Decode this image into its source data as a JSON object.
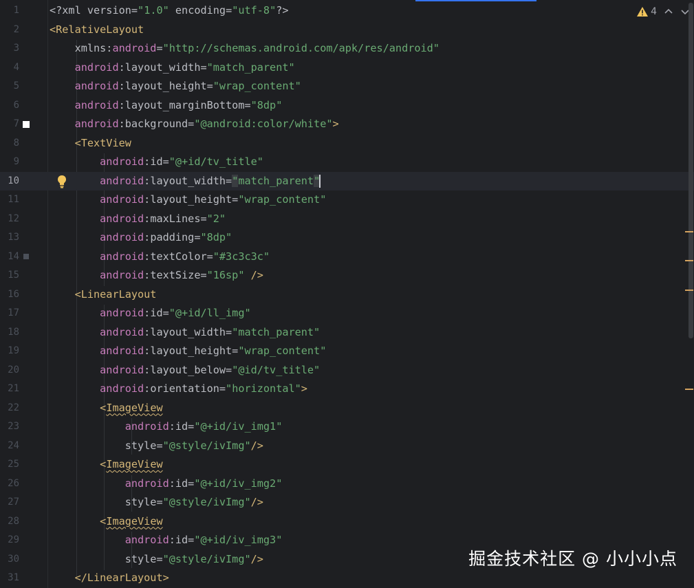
{
  "editor": {
    "current_line": 10,
    "lines": [
      {
        "n": "1",
        "segments": [
          {
            "t": "<?xml ",
            "c": "pi"
          },
          {
            "t": "version",
            "c": "attr"
          },
          {
            "t": "=",
            "c": "attr"
          },
          {
            "t": "\"1.0\"",
            "c": "val"
          },
          {
            "t": " encoding",
            "c": "attr"
          },
          {
            "t": "=",
            "c": "attr"
          },
          {
            "t": "\"utf-8\"",
            "c": "val"
          },
          {
            "t": "?>",
            "c": "pi"
          }
        ]
      },
      {
        "n": "2",
        "segments": [
          {
            "t": "<RelativeLayout",
            "c": "tag"
          }
        ]
      },
      {
        "n": "3",
        "segments": [
          {
            "t": "    xmlns:",
            "c": "attr"
          },
          {
            "t": "android",
            "c": "attr-ns"
          },
          {
            "t": "=",
            "c": "attr"
          },
          {
            "t": "\"http://schemas.android.com/apk/res/android\"",
            "c": "val"
          }
        ]
      },
      {
        "n": "4",
        "segments": [
          {
            "t": "    ",
            "c": "attr"
          },
          {
            "t": "android",
            "c": "attr-ns"
          },
          {
            "t": ":layout_width=",
            "c": "attr"
          },
          {
            "t": "\"match_parent\"",
            "c": "val"
          }
        ]
      },
      {
        "n": "5",
        "segments": [
          {
            "t": "    ",
            "c": "attr"
          },
          {
            "t": "android",
            "c": "attr-ns"
          },
          {
            "t": ":layout_height=",
            "c": "attr"
          },
          {
            "t": "\"wrap_content\"",
            "c": "val"
          }
        ]
      },
      {
        "n": "6",
        "segments": [
          {
            "t": "    ",
            "c": "attr"
          },
          {
            "t": "android",
            "c": "attr-ns"
          },
          {
            "t": ":layout_marginBottom=",
            "c": "attr"
          },
          {
            "t": "\"8dp\"",
            "c": "val"
          }
        ]
      },
      {
        "n": "7",
        "segments": [
          {
            "t": "    ",
            "c": "attr"
          },
          {
            "t": "android",
            "c": "attr-ns"
          },
          {
            "t": ":background=",
            "c": "attr"
          },
          {
            "t": "\"@android:color/white\"",
            "c": "val"
          },
          {
            "t": ">",
            "c": "tag"
          }
        ]
      },
      {
        "n": "8",
        "segments": [
          {
            "t": "    ",
            "c": "attr"
          },
          {
            "t": "<TextView",
            "c": "tag"
          }
        ]
      },
      {
        "n": "9",
        "segments": [
          {
            "t": "        ",
            "c": "attr"
          },
          {
            "t": "android",
            "c": "attr-ns"
          },
          {
            "t": ":id=",
            "c": "attr"
          },
          {
            "t": "\"@+id/tv_title\"",
            "c": "val"
          }
        ]
      },
      {
        "n": "10",
        "segments": [
          {
            "t": "        ",
            "c": "attr"
          },
          {
            "t": "android",
            "c": "attr-ns"
          },
          {
            "t": ":layout_width=",
            "c": "attr"
          },
          {
            "t": "\"",
            "c": "val caret-box"
          },
          {
            "t": "match_parent",
            "c": "val"
          },
          {
            "t": "\"",
            "c": "val caret-box"
          },
          {
            "t": "",
            "c": "caret"
          }
        ]
      },
      {
        "n": "11",
        "segments": [
          {
            "t": "        ",
            "c": "attr"
          },
          {
            "t": "android",
            "c": "attr-ns"
          },
          {
            "t": ":layout_height=",
            "c": "attr"
          },
          {
            "t": "\"wrap_content\"",
            "c": "val"
          }
        ]
      },
      {
        "n": "12",
        "segments": [
          {
            "t": "        ",
            "c": "attr"
          },
          {
            "t": "android",
            "c": "attr-ns"
          },
          {
            "t": ":maxLines=",
            "c": "attr"
          },
          {
            "t": "\"2\"",
            "c": "val"
          }
        ]
      },
      {
        "n": "13",
        "segments": [
          {
            "t": "        ",
            "c": "attr"
          },
          {
            "t": "android",
            "c": "attr-ns"
          },
          {
            "t": ":padding=",
            "c": "attr"
          },
          {
            "t": "\"8dp\"",
            "c": "val"
          }
        ]
      },
      {
        "n": "14",
        "segments": [
          {
            "t": "        ",
            "c": "attr"
          },
          {
            "t": "android",
            "c": "attr-ns"
          },
          {
            "t": ":textColor=",
            "c": "attr"
          },
          {
            "t": "\"#3c3c3c\"",
            "c": "val"
          }
        ]
      },
      {
        "n": "15",
        "segments": [
          {
            "t": "        ",
            "c": "attr"
          },
          {
            "t": "android",
            "c": "attr-ns"
          },
          {
            "t": ":textSize=",
            "c": "attr"
          },
          {
            "t": "\"16sp\"",
            "c": "val"
          },
          {
            "t": " />",
            "c": "tag"
          }
        ]
      },
      {
        "n": "16",
        "segments": [
          {
            "t": "    ",
            "c": "attr"
          },
          {
            "t": "<LinearLayout",
            "c": "tag"
          }
        ]
      },
      {
        "n": "17",
        "segments": [
          {
            "t": "        ",
            "c": "attr"
          },
          {
            "t": "android",
            "c": "attr-ns"
          },
          {
            "t": ":id=",
            "c": "attr"
          },
          {
            "t": "\"@+id/ll_img\"",
            "c": "val"
          }
        ]
      },
      {
        "n": "18",
        "segments": [
          {
            "t": "        ",
            "c": "attr"
          },
          {
            "t": "android",
            "c": "attr-ns"
          },
          {
            "t": ":layout_width=",
            "c": "attr"
          },
          {
            "t": "\"match_parent\"",
            "c": "val"
          }
        ]
      },
      {
        "n": "19",
        "segments": [
          {
            "t": "        ",
            "c": "attr"
          },
          {
            "t": "android",
            "c": "attr-ns"
          },
          {
            "t": ":layout_height=",
            "c": "attr"
          },
          {
            "t": "\"wrap_content\"",
            "c": "val"
          }
        ]
      },
      {
        "n": "20",
        "segments": [
          {
            "t": "        ",
            "c": "attr"
          },
          {
            "t": "android",
            "c": "attr-ns"
          },
          {
            "t": ":layout_below=",
            "c": "attr"
          },
          {
            "t": "\"@id/tv_title\"",
            "c": "val"
          }
        ]
      },
      {
        "n": "21",
        "segments": [
          {
            "t": "        ",
            "c": "attr"
          },
          {
            "t": "android",
            "c": "attr-ns"
          },
          {
            "t": ":orientation=",
            "c": "attr"
          },
          {
            "t": "\"horizontal\"",
            "c": "val"
          },
          {
            "t": ">",
            "c": "tag"
          }
        ]
      },
      {
        "n": "22",
        "segments": [
          {
            "t": "        ",
            "c": "attr"
          },
          {
            "t": "<",
            "c": "tag"
          },
          {
            "t": "ImageView",
            "c": "tag squiggle"
          }
        ]
      },
      {
        "n": "23",
        "segments": [
          {
            "t": "            ",
            "c": "attr"
          },
          {
            "t": "android",
            "c": "attr-ns"
          },
          {
            "t": ":id=",
            "c": "attr"
          },
          {
            "t": "\"@+id/iv_img1\"",
            "c": "val"
          }
        ]
      },
      {
        "n": "24",
        "segments": [
          {
            "t": "            style=",
            "c": "attr"
          },
          {
            "t": "\"@style/ivImg\"",
            "c": "val"
          },
          {
            "t": "/>",
            "c": "tag"
          }
        ]
      },
      {
        "n": "25",
        "segments": [
          {
            "t": "        ",
            "c": "attr"
          },
          {
            "t": "<",
            "c": "tag"
          },
          {
            "t": "ImageView",
            "c": "tag squiggle"
          }
        ]
      },
      {
        "n": "26",
        "segments": [
          {
            "t": "            ",
            "c": "attr"
          },
          {
            "t": "android",
            "c": "attr-ns"
          },
          {
            "t": ":id=",
            "c": "attr"
          },
          {
            "t": "\"@+id/iv_img2\"",
            "c": "val"
          }
        ]
      },
      {
        "n": "27",
        "segments": [
          {
            "t": "            style=",
            "c": "attr"
          },
          {
            "t": "\"@style/ivImg\"",
            "c": "val"
          },
          {
            "t": "/>",
            "c": "tag"
          }
        ]
      },
      {
        "n": "28",
        "segments": [
          {
            "t": "        ",
            "c": "attr"
          },
          {
            "t": "<",
            "c": "tag"
          },
          {
            "t": "ImageView",
            "c": "tag squiggle"
          }
        ]
      },
      {
        "n": "29",
        "segments": [
          {
            "t": "            ",
            "c": "attr"
          },
          {
            "t": "android",
            "c": "attr-ns"
          },
          {
            "t": ":id=",
            "c": "attr"
          },
          {
            "t": "\"@+id/iv_img3\"",
            "c": "val"
          }
        ]
      },
      {
        "n": "30",
        "segments": [
          {
            "t": "            style=",
            "c": "attr"
          },
          {
            "t": "\"@style/ivImg\"",
            "c": "val"
          },
          {
            "t": "/>",
            "c": "tag"
          }
        ]
      },
      {
        "n": "31",
        "segments": [
          {
            "t": "    ",
            "c": "attr"
          },
          {
            "t": "</LinearLayout>",
            "c": "tag"
          }
        ]
      }
    ]
  },
  "inspections": {
    "warning_count": "4",
    "icon": "warning-triangle-icon",
    "nav_up": "chevron-up-icon",
    "nav_down": "chevron-down-icon"
  },
  "watermark": "掘金技术社区 @ 小小小点",
  "colors": {
    "tag": "#d5b778",
    "namespace": "#c77dbb",
    "value": "#6aab73",
    "text": "#bcbec4",
    "background": "#1e1f22"
  }
}
